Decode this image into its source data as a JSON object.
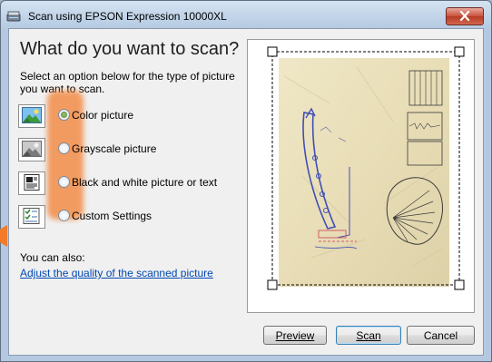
{
  "window": {
    "title": "Scan using EPSON Expression 10000XL"
  },
  "main": {
    "heading": "What do you want to scan?",
    "intro": "Select an option below for the type of picture you want to scan."
  },
  "options": [
    {
      "label": "Color picture",
      "icon": "color-picture-icon",
      "checked": true
    },
    {
      "label": "Grayscale picture",
      "icon": "grayscale-picture-icon",
      "checked": false
    },
    {
      "label": "Black and white picture or text",
      "icon": "black-white-text-icon",
      "checked": false
    },
    {
      "label": "Custom Settings",
      "icon": "custom-settings-icon",
      "checked": false
    }
  ],
  "also": {
    "label": "You can also:",
    "link": "Adjust the quality of the scanned picture"
  },
  "buttons": {
    "preview": "Preview",
    "scan": "Scan",
    "cancel": "Cancel"
  },
  "colors": {
    "highlight": "#f37a28",
    "link": "#0047b3",
    "selected_radio": "#4c7f22",
    "paper": "#efe6c4"
  }
}
